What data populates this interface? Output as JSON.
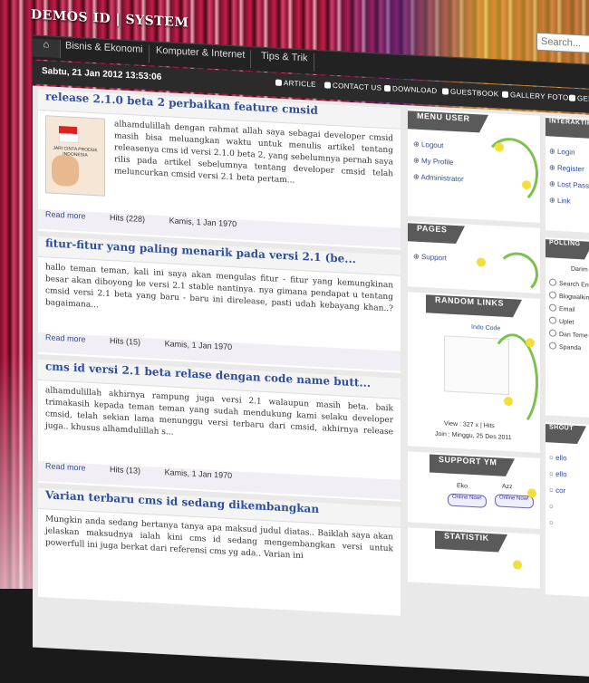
{
  "header": {
    "site_title": "DEMOS ID | SYSTEM",
    "search_placeholder": "Search..."
  },
  "nav": {
    "home_icon": "home-icon",
    "tabs": [
      "Bisnis & Ekonomi",
      "Komputer & Internet",
      "Tips & Trik"
    ]
  },
  "infobar": {
    "datetime": "Sabtu, 21 Jan 2012 13:53:06",
    "links": [
      "ARTICLE",
      "CONTACT US",
      "DOWNLOAD",
      "GUESTBOOK",
      "GALLERY FOTO",
      "GENE"
    ]
  },
  "posts": [
    {
      "title": "release 2.1.0 beta 2 perbaikan feature cmsid",
      "body": "alhamdulillah dengan rahmat allah saya sebagai developer cmsid masih bisa meluangkan waktu untuk menulis artikel tentang releasenya cms id versi 2.1.0 beta 2, yang sebelumnya pernah saya rilis pada artikel sebelumnya tentang developer cmsid telah meluncurkan cmsid versi 2.1 beta pertam...",
      "thumb_caption": "JARI CINTA PRODUK INDONESIA",
      "read_more": "Read more",
      "hits": "Hits (228)",
      "date": "Kamis, 1 Jan 1970"
    },
    {
      "title": "fitur-fitur yang paling menarik pada versi 2.1 (be...",
      "body": "hallo teman teman, kali ini saya akan mengulas fitur - fitur yang kemungkinan besar akan diboyong ke versi 2.1 stable nantinya. nya gimana pendapat u tentang cmsid versi 2.1 beta yang baru - baru ini direlease, pasti udah kebayang khan..? bagaimana...",
      "read_more": "Read more",
      "hits": "Hits (15)",
      "date": "Kamis, 1 Jan 1970"
    },
    {
      "title": "cms id versi 2.1 beta relase dengan code name butt...",
      "body": "alhamdulillah akhirnya rampung juga versi 2.1 walaupun masih beta. baik trimakasih kepada teman teman yang sudah mendukung kami selaku developer cmsid, telah sekian lama menunggu versi terbaru dari cmsid, akhirnya release juga.. khusus alhamdulillah s...",
      "read_more": "Read more",
      "hits": "Hits (13)",
      "date": "Kamis, 1 Jan 1970"
    },
    {
      "title": "Varian terbaru cms id sedang dikembangkan",
      "body": "Mungkin anda sedang bertanya tanya apa maksud judul diatas.. Baiklah saya akan jelaskan maksudnya ialah kini cms id sedang mengembangkan versi untuk powerfull ini juga berkat dari referensi cms yg ada.. Varian ini"
    }
  ],
  "sidebar": {
    "menu_user": {
      "title": "MENU USER",
      "items": [
        "Logout",
        "My Profile",
        "Administrator"
      ]
    },
    "pages": {
      "title": "PAGES",
      "items": [
        "Support"
      ]
    },
    "random_links": {
      "title": "RANDOM LINKS",
      "link": "Indo Code",
      "footer1": "View : 327 x | Hits",
      "footer2": "Join : Minggu, 25 Des 2011"
    },
    "support_ym": {
      "title": "SUPPORT YM",
      "names": [
        "Eko",
        "Azz"
      ],
      "status": [
        "Online Now!",
        "Online Now!"
      ]
    },
    "statistik": {
      "title": "STATISTIK"
    }
  },
  "rightcol": {
    "interaktif": {
      "title": "INTERAKTIF",
      "items": [
        "Login",
        "Register",
        "Lost Password",
        "Link"
      ]
    },
    "polling": {
      "title": "POLLING",
      "question": "Darim",
      "options": [
        "Search Engi",
        "Blogwalkin",
        "Email",
        "Uplet",
        "Dari Teme",
        "Spanda"
      ]
    },
    "shoutbox": {
      "title": "SHOUT",
      "items": [
        "ello",
        "ello",
        "cor",
        "",
        ""
      ]
    }
  },
  "colors": {
    "accent": "#2f4f9c",
    "nav_bg": "#222222",
    "box_head": "#5a5a5a"
  }
}
